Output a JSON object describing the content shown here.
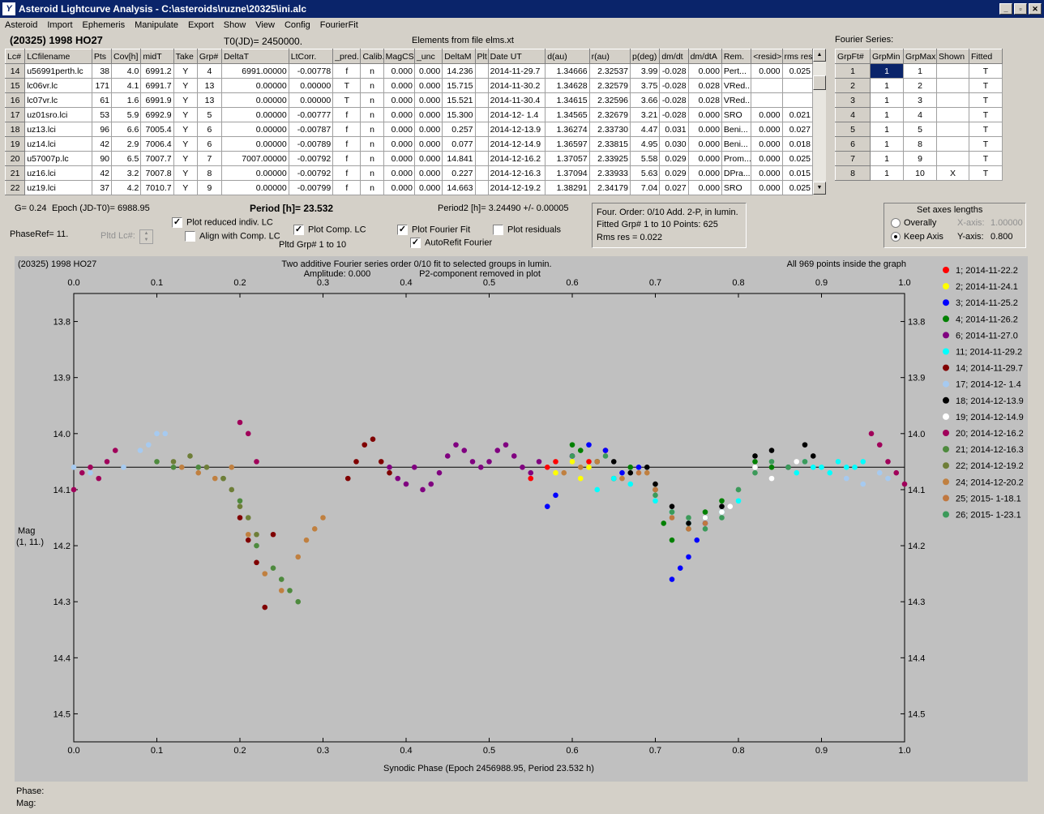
{
  "window": {
    "title": "Asteroid Lightcurve Analysis - C:\\asteroids\\ruzne\\20325\\ini.alc",
    "icon": "app-icon",
    "btn_min": "_",
    "btn_max": "▫",
    "btn_close": "✕"
  },
  "menu": [
    "Asteroid",
    "Import",
    "Ephemeris",
    "Manipulate",
    "Export",
    "Show",
    "View",
    "Config",
    "FourierFit"
  ],
  "header": {
    "asteroid": "(20325) 1998 HO27",
    "t0": "T0(JD)= 2450000.",
    "elements": "Elements from file elms.xt",
    "fourier_label": "Fourier Series:"
  },
  "lc_table": {
    "columns": [
      "Lc#",
      "LCfilename",
      "Pts",
      "Cov[h]",
      "midT",
      "Take",
      "Grp#",
      "DeltaT",
      "LtCorr.",
      "_pred.",
      "Calib.",
      "MagCS",
      "_unc",
      "DeltaM",
      "Plt",
      "Date UT",
      "d(au)",
      "r(au)",
      "p(deg)",
      "dm/dt",
      "dm/dtA",
      "Rem.",
      "<resid>",
      "rms res"
    ],
    "rows": [
      [
        "14",
        "u56991perth.lc",
        "38",
        "4.0",
        "6991.2",
        "Y",
        "4",
        "6991.00000",
        "-0.00778",
        "f",
        "n",
        "0.000",
        "0.000",
        "14.236",
        "",
        "2014-11-29.7",
        "1.34666",
        "2.32537",
        "3.99",
        "-0.028",
        "0.000",
        "Pert...",
        "0.000",
        "0.025"
      ],
      [
        "15",
        "lc06vr.lc",
        "171",
        "4.1",
        "6991.7",
        "Y",
        "13",
        "0.00000",
        "0.00000",
        "T",
        "n",
        "0.000",
        "0.000",
        "15.715",
        "",
        "2014-11-30.2",
        "1.34628",
        "2.32579",
        "3.75",
        "-0.028",
        "0.028",
        "VRed...",
        "",
        ""
      ],
      [
        "16",
        "lc07vr.lc",
        "61",
        "1.6",
        "6991.9",
        "Y",
        "13",
        "0.00000",
        "0.00000",
        "T",
        "n",
        "0.000",
        "0.000",
        "15.521",
        "",
        "2014-11-30.4",
        "1.34615",
        "2.32596",
        "3.66",
        "-0.028",
        "0.028",
        "VRed...",
        "",
        ""
      ],
      [
        "17",
        "uz01sro.lci",
        "53",
        "5.9",
        "6992.9",
        "Y",
        "5",
        "0.00000",
        "-0.00777",
        "f",
        "n",
        "0.000",
        "0.000",
        "15.300",
        "",
        "2014-12- 1.4",
        "1.34565",
        "2.32679",
        "3.21",
        "-0.028",
        "0.000",
        "SRO",
        "0.000",
        "0.021"
      ],
      [
        "18",
        "uz13.lci",
        "96",
        "6.6",
        "7005.4",
        "Y",
        "6",
        "0.00000",
        "-0.00787",
        "f",
        "n",
        "0.000",
        "0.000",
        "0.257",
        "",
        "2014-12-13.9",
        "1.36274",
        "2.33730",
        "4.47",
        "0.031",
        "0.000",
        "Beni...",
        "0.000",
        "0.027"
      ],
      [
        "19",
        "uz14.lci",
        "42",
        "2.9",
        "7006.4",
        "Y",
        "6",
        "0.00000",
        "-0.00789",
        "f",
        "n",
        "0.000",
        "0.000",
        "0.077",
        "",
        "2014-12-14.9",
        "1.36597",
        "2.33815",
        "4.95",
        "0.030",
        "0.000",
        "Beni...",
        "0.000",
        "0.018"
      ],
      [
        "20",
        "u57007p.lc",
        "90",
        "6.5",
        "7007.7",
        "Y",
        "7",
        "7007.00000",
        "-0.00792",
        "f",
        "n",
        "0.000",
        "0.000",
        "14.841",
        "",
        "2014-12-16.2",
        "1.37057",
        "2.33925",
        "5.58",
        "0.029",
        "0.000",
        "Prom...",
        "0.000",
        "0.025"
      ],
      [
        "21",
        "uz16.lci",
        "42",
        "3.2",
        "7007.8",
        "Y",
        "8",
        "0.00000",
        "-0.00792",
        "f",
        "n",
        "0.000",
        "0.000",
        "0.227",
        "",
        "2014-12-16.3",
        "1.37094",
        "2.33933",
        "5.63",
        "0.029",
        "0.000",
        "DPra...",
        "0.000",
        "0.015"
      ],
      [
        "22",
        "uz19.lci",
        "37",
        "4.2",
        "7010.7",
        "Y",
        "9",
        "0.00000",
        "-0.00799",
        "f",
        "n",
        "0.000",
        "0.000",
        "14.663",
        "",
        "2014-12-19.2",
        "1.38291",
        "2.34179",
        "7.04",
        "0.027",
        "0.000",
        "SRO",
        "0.000",
        "0.025"
      ]
    ]
  },
  "fourier_table": {
    "columns": [
      "GrpFt#",
      "GrpMin",
      "GrpMax",
      "Shown",
      "Fitted"
    ],
    "rows": [
      [
        "1",
        "1",
        "1",
        "",
        "T"
      ],
      [
        "2",
        "1",
        "2",
        "",
        "T"
      ],
      [
        "3",
        "1",
        "3",
        "",
        "T"
      ],
      [
        "4",
        "1",
        "4",
        "",
        "T"
      ],
      [
        "5",
        "1",
        "5",
        "",
        "T"
      ],
      [
        "6",
        "1",
        "8",
        "",
        "T"
      ],
      [
        "7",
        "1",
        "9",
        "",
        "T"
      ],
      [
        "8",
        "1",
        "10",
        "X",
        "T"
      ]
    ]
  },
  "controls": {
    "g": "G= 0.24",
    "epoch": "Epoch (JD-T0)= 6988.95",
    "period": "Period [h]= 23.532",
    "period2": "Period2 [h]= 3.24490 +/- 0.00005",
    "phaseref": "PhaseRef= 11.",
    "pltd_lc": "Pltd Lc#:",
    "cb_reduced": "Plot reduced indiv. LC",
    "cb_align": "Align with Comp. LC",
    "cb_comp": "Plot Comp. LC",
    "cb_fourier": "Plot Fourier Fit",
    "cb_resid": "Plot residuals",
    "cb_autorefit": "AutoRefit Fourier",
    "cb_reduced_on": true,
    "cb_align_on": false,
    "cb_comp_on": true,
    "cb_fourier_on": true,
    "cb_resid_on": false,
    "cb_autorefit_on": true,
    "pltd_grp": "Pltd Grp#  1   to   10",
    "info1": "Four. Order:  0/10    Add. 2-P, in lumin.",
    "info2": "Fitted Grp# 1 to 10    Points: 625",
    "info3": "Rms res     = 0.022",
    "axes_title": "Set axes lengths",
    "overally": "Overally",
    "keep_axis": "Keep Axis",
    "xaxis_label": "X-axis:",
    "xaxis_value": "1.00000",
    "yaxis_label": "Y-axis:",
    "yaxis_value": "0.800",
    "check_mark": "✓"
  },
  "chart_data": {
    "type": "scatter",
    "title_left": "(20325) 1998 HO27",
    "title_center1": "Two additive Fourier series order 0/10 fit to selected groups in lumin.",
    "title_center2a": "Amplitude: 0.000",
    "title_center2b": "P2-component removed in plot",
    "title_right": "All 969 points inside the graph",
    "xlabel": "Synodic Phase (Epoch 2456988.95, Period 23.532 h)",
    "ylabel1": "Mag",
    "ylabel2": "(1, 11.)",
    "xlim": [
      0,
      1
    ],
    "ylim": [
      14.55,
      13.75
    ],
    "xticks": [
      "0.0",
      "0.1",
      "0.2",
      "0.3",
      "0.4",
      "0.5",
      "0.6",
      "0.7",
      "0.8",
      "0.9",
      "1.0"
    ],
    "yticks": [
      "13.8",
      "13.9",
      "14.0",
      "14.1",
      "14.2",
      "14.3",
      "14.4",
      "14.5"
    ],
    "fit_line": 14.06,
    "background": "#c0c0c0",
    "series": [
      {
        "name": "1; 2014-11-22.2",
        "color": "#ff0000",
        "x": [
          0.55,
          0.57,
          0.58,
          0.6,
          0.62,
          0.64
        ],
        "y": [
          14.08,
          14.06,
          14.05,
          14.04,
          14.05,
          14.03
        ]
      },
      {
        "name": "2; 2014-11-24.1",
        "color": "#ffff00",
        "x": [
          0.58,
          0.6,
          0.61,
          0.62,
          0.63
        ],
        "y": [
          14.07,
          14.05,
          14.08,
          14.06,
          14.05
        ]
      },
      {
        "name": "3; 2014-11-25.2",
        "color": "#0000ff",
        "x": [
          0.57,
          0.58,
          0.6,
          0.62,
          0.63,
          0.64,
          0.66,
          0.68,
          0.72,
          0.73,
          0.74,
          0.75,
          0.76
        ],
        "y": [
          14.13,
          14.11,
          14.04,
          14.02,
          14.05,
          14.03,
          14.07,
          14.06,
          14.26,
          14.24,
          14.22,
          14.19,
          14.16
        ]
      },
      {
        "name": "4; 2014-11-26.2",
        "color": "#008000",
        "x": [
          0.6,
          0.61,
          0.63,
          0.65,
          0.67,
          0.7,
          0.71,
          0.72,
          0.74,
          0.76,
          0.78,
          0.82,
          0.84
        ],
        "y": [
          14.02,
          14.03,
          14.05,
          14.08,
          14.06,
          14.1,
          14.16,
          14.19,
          14.17,
          14.14,
          14.12,
          14.05,
          14.06
        ]
      },
      {
        "name": "6; 2014-11-27.0",
        "color": "#800080",
        "x": [
          0.38,
          0.39,
          0.4,
          0.41,
          0.42,
          0.43,
          0.44,
          0.45,
          0.46,
          0.47,
          0.48,
          0.49,
          0.5,
          0.51,
          0.52,
          0.53,
          0.54,
          0.55,
          0.56
        ],
        "y": [
          14.06,
          14.08,
          14.09,
          14.06,
          14.1,
          14.09,
          14.07,
          14.04,
          14.02,
          14.03,
          14.05,
          14.06,
          14.05,
          14.03,
          14.02,
          14.04,
          14.06,
          14.07,
          14.05
        ]
      },
      {
        "name": "11; 2014-11-29.2",
        "color": "#00ffff",
        "x": [
          0.63,
          0.65,
          0.67,
          0.7,
          0.72,
          0.74,
          0.76,
          0.78,
          0.8,
          0.86,
          0.87,
          0.88,
          0.89,
          0.9,
          0.91,
          0.92,
          0.93,
          0.94,
          0.95
        ],
        "y": [
          14.1,
          14.08,
          14.09,
          14.12,
          14.14,
          14.16,
          14.15,
          14.14,
          14.12,
          14.06,
          14.07,
          14.05,
          14.06,
          14.06,
          14.07,
          14.05,
          14.06,
          14.06,
          14.05
        ]
      },
      {
        "name": "14; 2014-11-29.7",
        "color": "#800000",
        "x": [
          0.2,
          0.21,
          0.22,
          0.23,
          0.24,
          0.33,
          0.34,
          0.35,
          0.36,
          0.37,
          0.38
        ],
        "y": [
          14.15,
          14.19,
          14.23,
          14.31,
          14.18,
          14.08,
          14.05,
          14.02,
          14.01,
          14.05,
          14.07
        ]
      },
      {
        "name": "17; 2014-12- 1.4",
        "color": "#a6caf0",
        "x": [
          0.0,
          0.02,
          0.04,
          0.06,
          0.08,
          0.09,
          0.1,
          0.11,
          0.93,
          0.95,
          0.97,
          0.98
        ],
        "y": [
          14.06,
          14.07,
          14.05,
          14.06,
          14.03,
          14.02,
          14.0,
          14.0,
          14.08,
          14.09,
          14.07,
          14.08
        ]
      },
      {
        "name": "18; 2014-12-13.9",
        "color": "#000000",
        "x": [
          0.65,
          0.67,
          0.69,
          0.7,
          0.72,
          0.74,
          0.76,
          0.78,
          0.8,
          0.82,
          0.84,
          0.86,
          0.88,
          0.89
        ],
        "y": [
          14.05,
          14.07,
          14.06,
          14.09,
          14.13,
          14.16,
          14.15,
          14.13,
          14.1,
          14.04,
          14.03,
          14.06,
          14.02,
          14.04
        ]
      },
      {
        "name": "19; 2014-12-14.9",
        "color": "#ffffff",
        "x": [
          0.76,
          0.78,
          0.79,
          0.8,
          0.82,
          0.84,
          0.87
        ],
        "y": [
          14.15,
          14.14,
          14.13,
          14.1,
          14.06,
          14.08,
          14.05
        ]
      },
      {
        "name": "20; 2014-12-16.2",
        "color": "#a0005a",
        "x": [
          0.0,
          0.01,
          0.02,
          0.03,
          0.04,
          0.05,
          0.2,
          0.21,
          0.22,
          0.96,
          0.97,
          0.98,
          0.99,
          1.0
        ],
        "y": [
          14.1,
          14.07,
          14.06,
          14.08,
          14.05,
          14.03,
          13.98,
          14.0,
          14.05,
          14.0,
          14.02,
          14.05,
          14.07,
          14.09
        ]
      },
      {
        "name": "21; 2014-12-16.3",
        "color": "#4e8a3e",
        "x": [
          0.1,
          0.12,
          0.15,
          0.18,
          0.2,
          0.22,
          0.24,
          0.25,
          0.26,
          0.27
        ],
        "y": [
          14.05,
          14.06,
          14.06,
          14.08,
          14.12,
          14.2,
          14.24,
          14.26,
          14.28,
          14.3
        ]
      },
      {
        "name": "22; 2014-12-19.2",
        "color": "#6e7e38",
        "x": [
          0.12,
          0.14,
          0.16,
          0.18,
          0.19,
          0.2,
          0.21,
          0.22
        ],
        "y": [
          14.05,
          14.04,
          14.06,
          14.08,
          14.1,
          14.13,
          14.15,
          14.18
        ]
      },
      {
        "name": "24; 2014-12-20.2",
        "color": "#c08040",
        "x": [
          0.13,
          0.15,
          0.17,
          0.19,
          0.21,
          0.23,
          0.25,
          0.27,
          0.28,
          0.29,
          0.3,
          0.59,
          0.61,
          0.63,
          0.66,
          0.69
        ],
        "y": [
          14.06,
          14.07,
          14.08,
          14.06,
          14.18,
          14.25,
          14.28,
          14.22,
          14.19,
          14.17,
          14.15,
          14.07,
          14.06,
          14.05,
          14.08,
          14.07
        ]
      },
      {
        "name": "25; 2015- 1-18.1",
        "color": "#c07840",
        "x": [
          0.68,
          0.7,
          0.72,
          0.74,
          0.76
        ],
        "y": [
          14.07,
          14.1,
          14.15,
          14.17,
          14.16
        ]
      },
      {
        "name": "26; 2015- 1-23.1",
        "color": "#3c9a5a",
        "x": [
          0.6,
          0.64,
          0.7,
          0.72,
          0.74,
          0.76,
          0.78,
          0.8,
          0.82,
          0.84,
          0.86,
          0.88
        ],
        "y": [
          14.04,
          14.04,
          14.11,
          14.14,
          14.15,
          14.17,
          14.15,
          14.1,
          14.07,
          14.05,
          14.06,
          14.05
        ]
      }
    ]
  },
  "status": {
    "phase": "Phase:",
    "mag": "Mag:"
  }
}
